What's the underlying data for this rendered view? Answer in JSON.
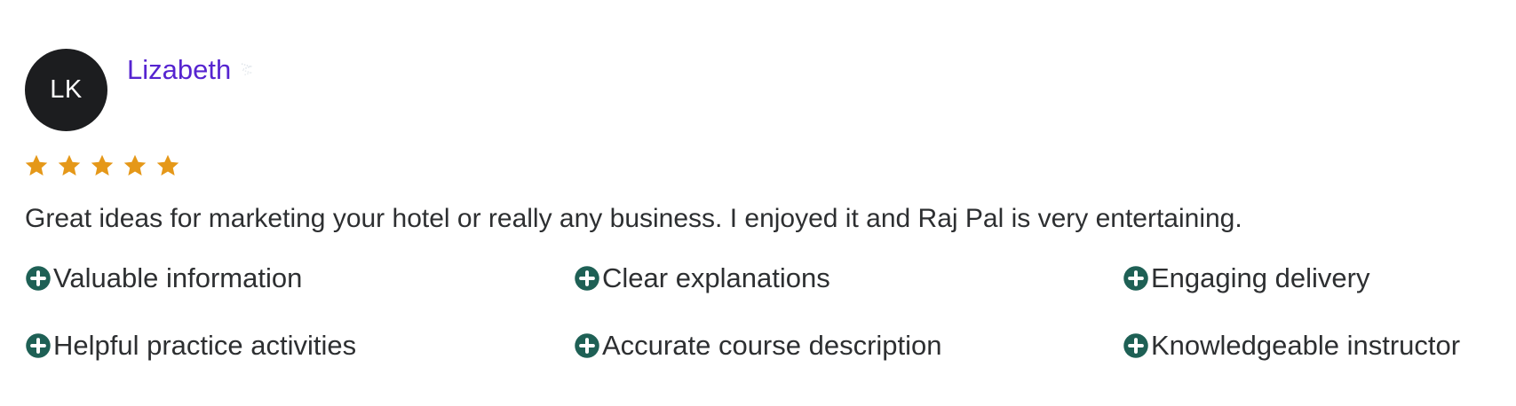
{
  "reviewer": {
    "initials": "LK",
    "name": "Lizabeth",
    "avatar_color": "#1c1d1f",
    "name_color": "#5624d0"
  },
  "rating": {
    "value": 5,
    "max": 5,
    "star_color": "#e59819",
    "icon": "star-icon"
  },
  "review_text": "Great ideas for marketing your hotel or really any business. I enjoyed it and Raj Pal is very entertaining.",
  "tags": {
    "icon": "plus-circle-icon",
    "icon_color": "#1e6055",
    "items": [
      {
        "label": "Valuable information"
      },
      {
        "label": "Clear explanations"
      },
      {
        "label": "Engaging delivery"
      },
      {
        "label": "Helpful practice activities"
      },
      {
        "label": "Accurate course description"
      },
      {
        "label": "Knowledgeable instructor"
      }
    ]
  }
}
